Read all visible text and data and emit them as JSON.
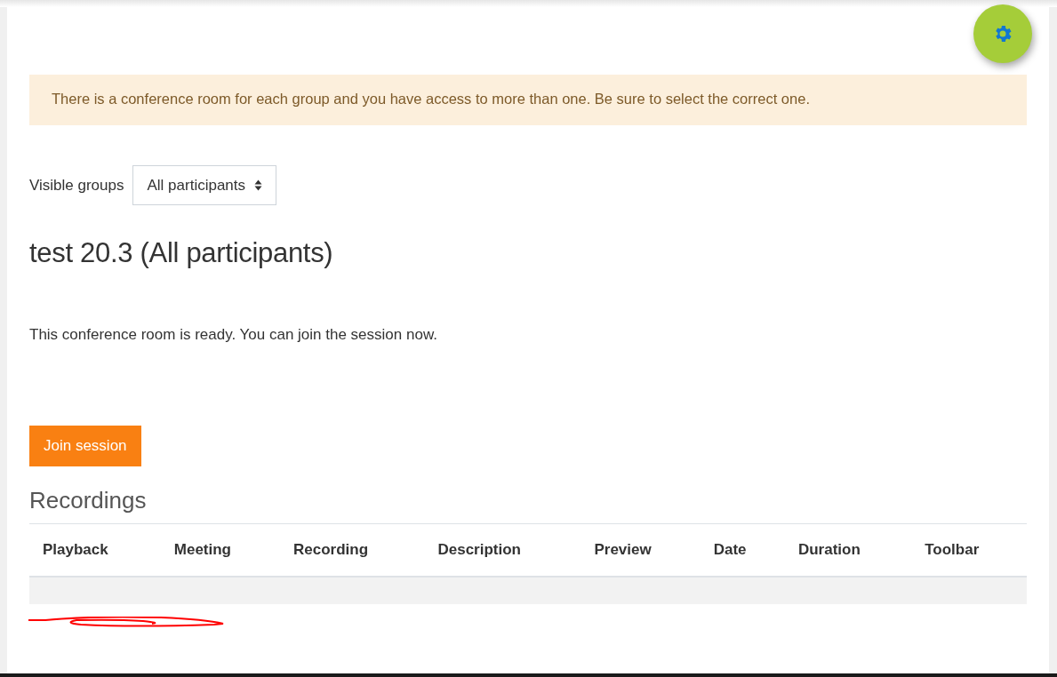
{
  "alert": {
    "text": "There is a conference room for each group and you have access to more than one. Be sure to select the correct one."
  },
  "group_select": {
    "label": "Visible groups",
    "value": "All participants"
  },
  "room_title": "test 20.3 (All participants)",
  "status_text": "This conference room is ready. You can join the session now.",
  "join_button": "Join session",
  "recordings": {
    "title": "Recordings",
    "columns": [
      "Playback",
      "Meeting",
      "Recording",
      "Description",
      "Preview",
      "Date",
      "Duration",
      "Toolbar"
    ]
  }
}
